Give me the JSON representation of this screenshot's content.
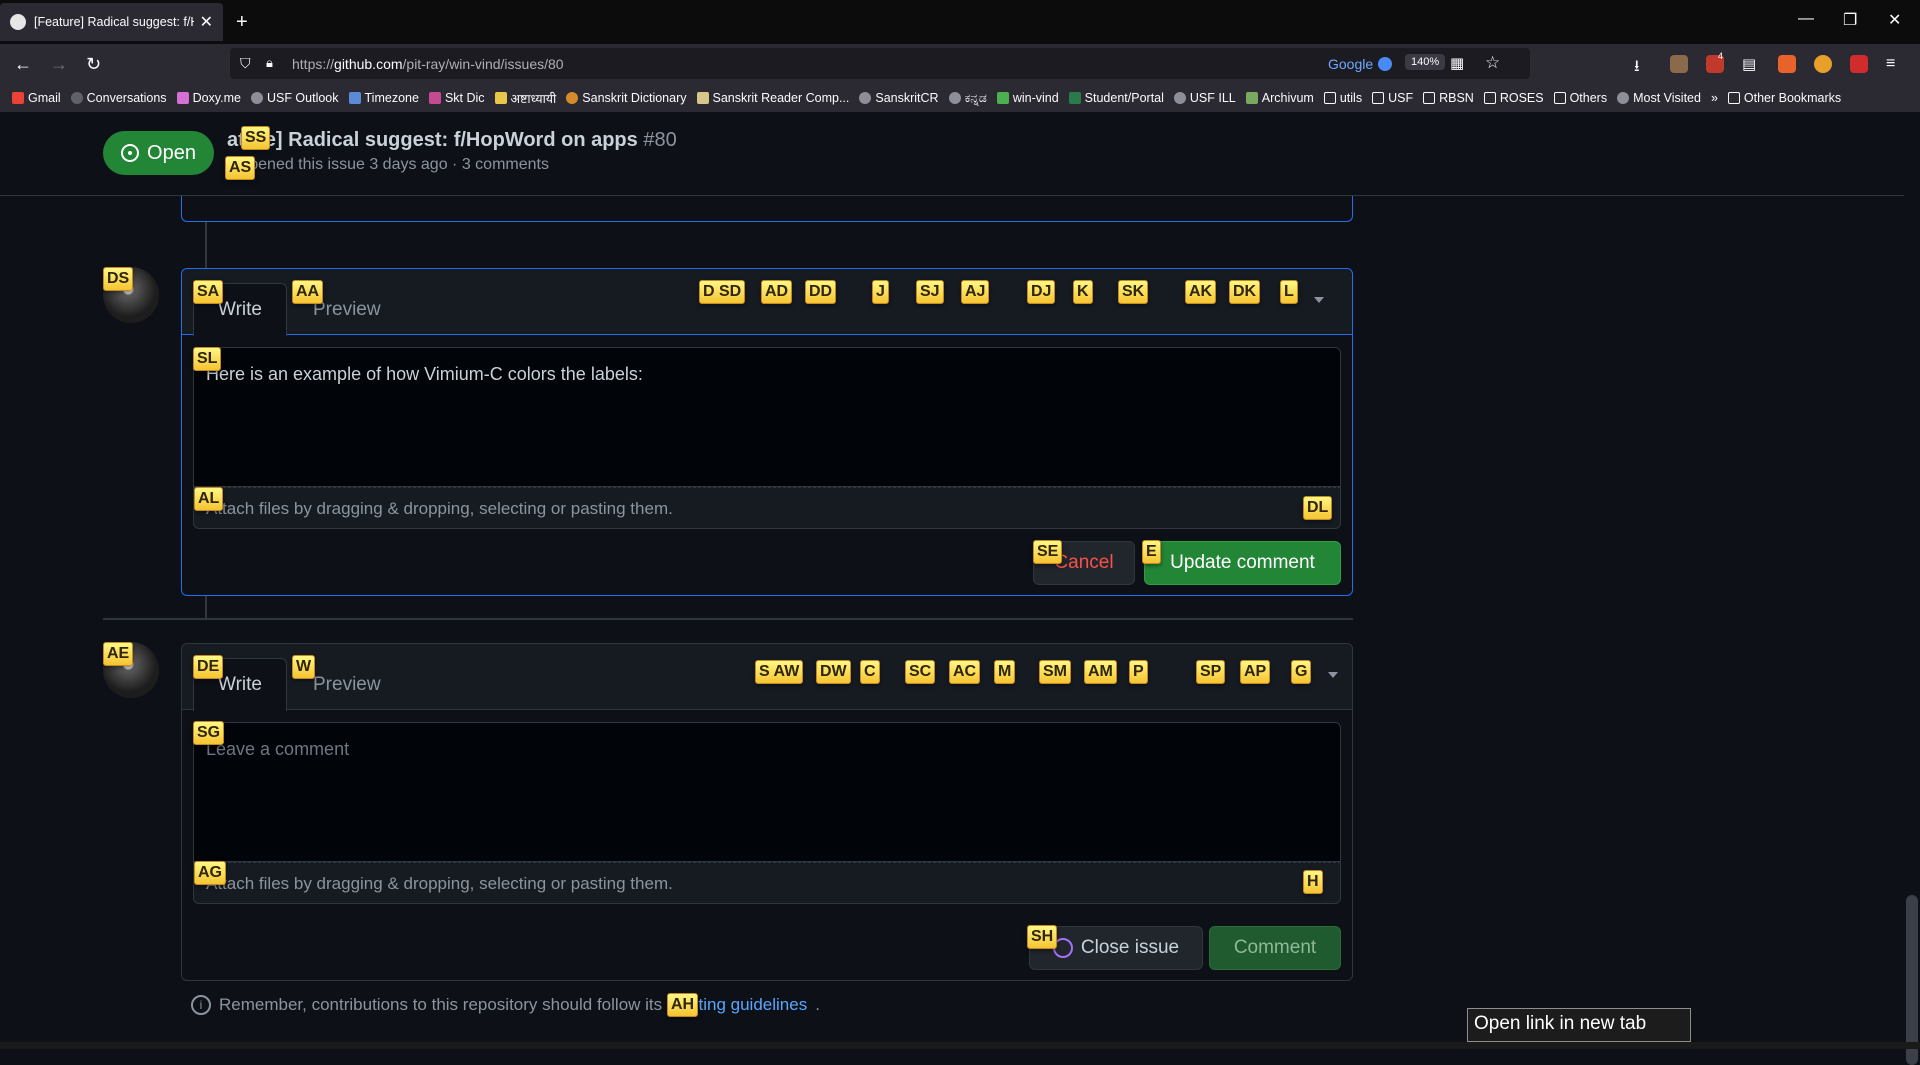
{
  "browser": {
    "tab_title": "[Feature] Radical suggest: f/HopWord on apps",
    "tab_close": "✕",
    "new_tab": "+",
    "url_prefix": "https://",
    "url_host": "github.com",
    "url_path": "/pit-ray/win-vind/issues/80",
    "search_engine": "Google",
    "zoom": "140%",
    "notification_count": "4",
    "bookmarks": [
      "Gmail",
      "Conversations",
      "Doxy.me",
      "USF Outlook",
      "Timezone",
      "Skt Dic",
      "अष्टाध्यायी",
      "Sanskrit Dictionary",
      "Sanskrit Reader Comp...",
      "SanskritCR",
      "ಕನ್ನಡ",
      "win-vind",
      "Student/Portal",
      "USF ILL",
      "Archivum",
      "utils",
      "USF",
      "RBSN",
      "ROSES",
      "Others",
      "Most Visited",
      "»",
      "Other Bookmarks"
    ]
  },
  "issue": {
    "state": "Open",
    "title_visible": "ature] Radical suggest: f/HopWord on apps",
    "number": "#80",
    "meta": "n opened this issue 3 days ago · 3 comments"
  },
  "edit_comment": {
    "tab_write": "Write",
    "tab_preview": "Preview",
    "text": "Here is an example of how Vimium-C colors the labels:",
    "attach_hint": "Attach files by dragging & dropping, selecting or pasting them.",
    "cancel_label": "Cancel",
    "update_label": "Update comment"
  },
  "new_comment": {
    "tab_write": "Write",
    "tab_preview": "Preview",
    "placeholder": "Leave a comment",
    "attach_hint": "Attach files by dragging & dropping, selecting or pasting them.",
    "close_label": "Close issue",
    "comment_label": "Comment"
  },
  "footer": {
    "text_before": "Remember, contributions to this repository should follow its",
    "link": "ributing guidelines",
    "text_after": "."
  },
  "tooltip": "Open link in new tab",
  "hints": [
    "SS",
    "AS",
    "DS",
    "SA",
    "AA",
    "D SD",
    "AD",
    "DD",
    "J",
    "SJ",
    "AJ",
    "DJ",
    "K",
    "SK",
    "AK",
    "DK",
    "L",
    "SL",
    "AL",
    "DL",
    "SE",
    "E",
    "AE",
    "DE",
    "W",
    "S AW",
    "DW",
    "C",
    "SC",
    "AC",
    "M",
    "SM",
    "AM",
    "P",
    "SP",
    "AP",
    "G",
    "SG",
    "AG",
    "H",
    "SH",
    "AH"
  ],
  "colors": {
    "page_bg": "#0d1117",
    "open_green": "#238636",
    "focus_blue": "#1f6feb",
    "cancel_red": "#f85149",
    "link_blue": "#58a6ff",
    "hint_yellow": "#f5c431"
  }
}
